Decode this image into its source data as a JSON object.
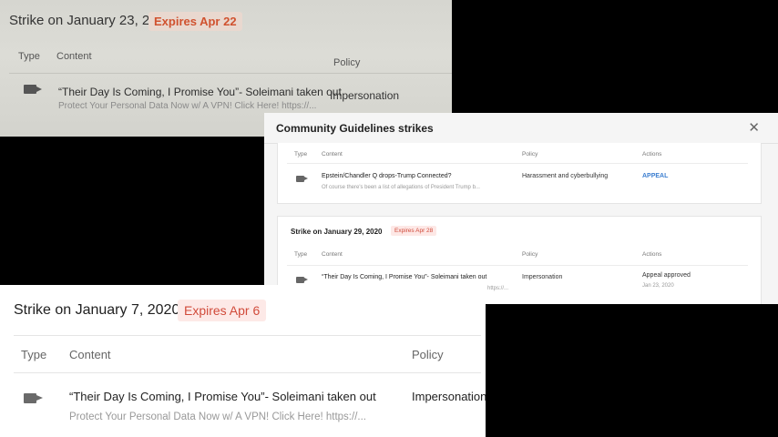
{
  "panel_top": {
    "strike_title": "Strike on January 23, 2020",
    "expires": "Expires Apr 22",
    "headers": {
      "type": "Type",
      "content": "Content",
      "policy": "Policy"
    },
    "row": {
      "content": "“Their Day Is Coming, I Promise You”- Soleimani taken out",
      "description": "Protect Your Personal Data Now w/ A VPN! Click Here! https://...",
      "policy": "Impersonation"
    }
  },
  "dialog": {
    "title": "Community Guidelines strikes",
    "close_icon": "✕",
    "card1": {
      "headers": {
        "type": "Type",
        "content": "Content",
        "policy": "Policy",
        "actions": "Actions"
      },
      "row": {
        "content": "Epstein/Chandler Q drops-Trump Connected?",
        "description": "Of course there's been a list of allegations of President Trump b...",
        "policy": "Harassment and cyberbullying",
        "action": "APPEAL"
      }
    },
    "card2": {
      "strike_title": "Strike on January 29, 2020",
      "expires": "Expires Apr 28",
      "headers": {
        "type": "Type",
        "content": "Content",
        "policy": "Policy",
        "actions": "Actions"
      },
      "row": {
        "content": "“Their Day Is Coming, I Promise You”- Soleimani taken out",
        "description": "https://...",
        "policy": "Impersonation",
        "action": "Appeal approved",
        "action_date": "Jan 23, 2020"
      }
    }
  },
  "panel_bottom": {
    "strike_title": "Strike on January 7, 2020",
    "expires": "Expires Apr 6",
    "headers": {
      "type": "Type",
      "content": "Content",
      "policy": "Policy"
    },
    "row": {
      "content": "“Their Day Is Coming, I Promise You”- Soleimani taken out",
      "description": "Protect Your Personal Data Now w/ A VPN! Click Here! https://...",
      "policy": "Impersonation"
    }
  },
  "colors": {
    "expires_text": "#d14b3b",
    "expires_bg": "#fde9e7",
    "appeal_link": "#3d7fd0"
  },
  "icons": {
    "video": "video-camera-icon",
    "close": "close-icon"
  }
}
